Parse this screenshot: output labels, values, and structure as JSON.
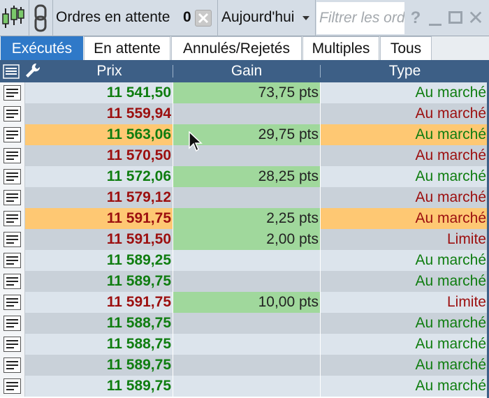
{
  "toolbar": {
    "orders_label": "Ordres en attente",
    "orders_count": "0",
    "date_filter": "Aujourd'hui",
    "filter_placeholder": "Filtrer les ordres",
    "help_label": "?"
  },
  "tabs": [
    {
      "label": "Exécutés",
      "active": true
    },
    {
      "label": "En attente",
      "active": false
    },
    {
      "label": "Annulés/Rejetés",
      "active": false
    },
    {
      "label": "Multiples",
      "active": false
    },
    {
      "label": "Tous",
      "active": false
    }
  ],
  "columns": {
    "prix": "Prix",
    "gain": "Gain",
    "type": "Type"
  },
  "colors": {
    "buy": "#0f7d10",
    "sell": "#9c0f0f",
    "gain_bg": "#a0d89c",
    "highlight_bg": "#fec873",
    "header_bg": "#3d5f86",
    "tab_active_bg": "#2f79c8"
  },
  "rows": [
    {
      "prix": "11 541,50",
      "gain": "73,75 pts",
      "type": "Au marché",
      "prix_color": "green",
      "type_color": "green",
      "highlight": false
    },
    {
      "prix": "11 559,94",
      "gain": "",
      "type": "Au marché",
      "prix_color": "red",
      "type_color": "red",
      "highlight": false
    },
    {
      "prix": "11 563,06",
      "gain": "29,75 pts",
      "type": "Au marché",
      "prix_color": "green",
      "type_color": "green",
      "highlight": true
    },
    {
      "prix": "11 570,50",
      "gain": "",
      "type": "Au marché",
      "prix_color": "red",
      "type_color": "red",
      "highlight": false
    },
    {
      "prix": "11 572,06",
      "gain": "28,25 pts",
      "type": "Au marché",
      "prix_color": "green",
      "type_color": "green",
      "highlight": false
    },
    {
      "prix": "11 579,12",
      "gain": "",
      "type": "Au marché",
      "prix_color": "red",
      "type_color": "red",
      "highlight": false
    },
    {
      "prix": "11 591,75",
      "gain": "2,25 pts",
      "type": "Au marché",
      "prix_color": "red",
      "type_color": "red",
      "highlight": true
    },
    {
      "prix": "11 591,50",
      "gain": "2,00 pts",
      "type": "Limite",
      "prix_color": "red",
      "type_color": "red",
      "highlight": false
    },
    {
      "prix": "11 589,25",
      "gain": "",
      "type": "Au marché",
      "prix_color": "green",
      "type_color": "green",
      "highlight": false
    },
    {
      "prix": "11 589,75",
      "gain": "",
      "type": "Au marché",
      "prix_color": "green",
      "type_color": "green",
      "highlight": false
    },
    {
      "prix": "11 591,75",
      "gain": "10,00 pts",
      "type": "Limite",
      "prix_color": "red",
      "type_color": "red",
      "highlight": false
    },
    {
      "prix": "11 588,75",
      "gain": "",
      "type": "Au marché",
      "prix_color": "green",
      "type_color": "green",
      "highlight": false
    },
    {
      "prix": "11 588,75",
      "gain": "",
      "type": "Au marché",
      "prix_color": "green",
      "type_color": "green",
      "highlight": false
    },
    {
      "prix": "11 589,75",
      "gain": "",
      "type": "Au marché",
      "prix_color": "green",
      "type_color": "green",
      "highlight": false
    },
    {
      "prix": "11 589,75",
      "gain": "",
      "type": "Au marché",
      "prix_color": "green",
      "type_color": "green",
      "highlight": false
    }
  ]
}
